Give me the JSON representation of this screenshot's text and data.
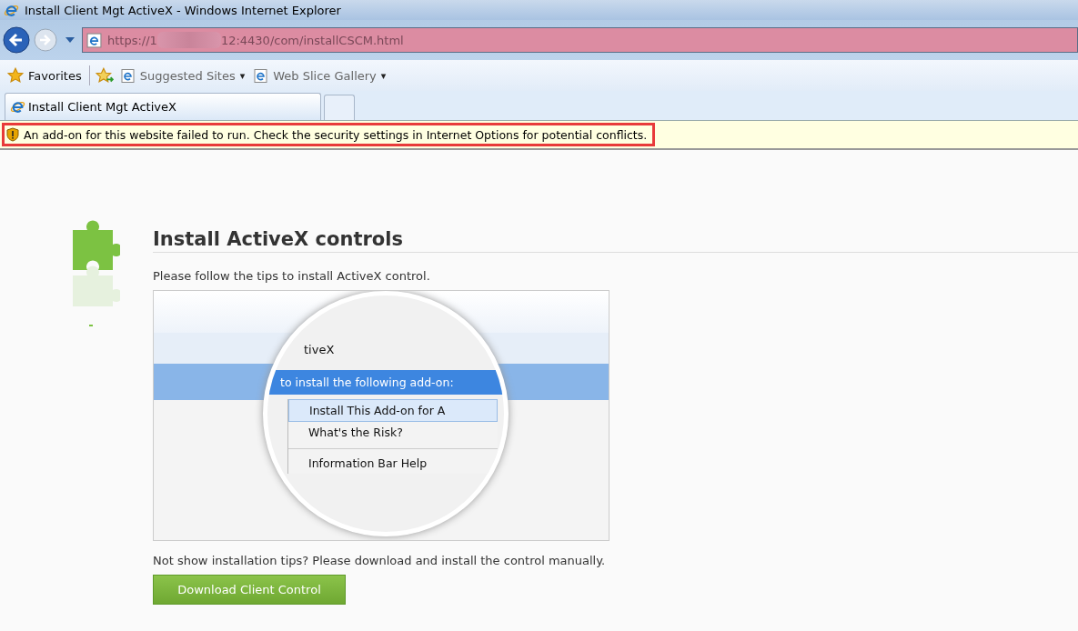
{
  "window": {
    "title": "Install Client Mgt ActiveX - Windows Internet Explorer"
  },
  "address_bar": {
    "url_start": "https://1",
    "url_end": "12:4430/com/installCSCM.html"
  },
  "favorites_bar": {
    "favorites": "Favorites",
    "links": [
      {
        "label": "Suggested Sites",
        "caret": "▾"
      },
      {
        "label": "Web Slice Gallery",
        "caret": "▾"
      }
    ]
  },
  "tabs": [
    {
      "label": "Install Client Mgt ActiveX",
      "selected": true
    },
    {
      "selected": false
    }
  ],
  "info_bar": {
    "message": "An add-on for this website failed to run. Check the security settings in Internet Options for potential conflicts."
  },
  "page": {
    "heading": "Install ActiveX controls",
    "intro": "Please follow the tips to install ActiveX control.",
    "tip_image": {
      "tab_text": "tiveX",
      "bar_text": "to install the following add-on:",
      "menu": [
        "Install This Add-on for A",
        "What's the Risk?",
        "Information Bar Help"
      ]
    },
    "manual_note": "Not show installation tips? Please download and install the control manually.",
    "download_button": "Download Client Control"
  }
}
